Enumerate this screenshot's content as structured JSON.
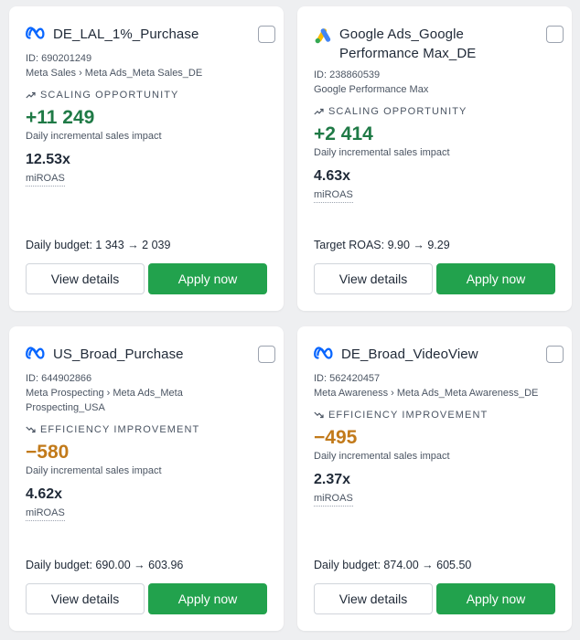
{
  "colors": {
    "positive": "#1f7a46",
    "negative": "#c27a1a",
    "apply_button": "#22a24d"
  },
  "cards": [
    {
      "platform_icon": "meta-logo",
      "title": "DE_LAL_1%_Purchase",
      "id_label": "ID: 690201249",
      "path": "Meta Sales › Meta Ads_Meta Sales_DE",
      "tag_icon": "trend-up-icon",
      "tag": "SCALING OPPORTUNITY",
      "impact": "+11 249",
      "impact_label": "Daily incremental sales impact",
      "metric": "12.53x",
      "metric_label": "miROAS",
      "budget": "Daily budget: 1 343 → 2 039",
      "view_label": "View details",
      "apply_label": "Apply now",
      "selected": false
    },
    {
      "platform_icon": "google-ads-logo",
      "title": "Google Ads_Google Performance Max_DE",
      "id_label": "ID: 238860539",
      "path": "Google Performance Max",
      "tag_icon": "trend-up-icon",
      "tag": "SCALING OPPORTUNITY",
      "impact": "+2 414",
      "impact_label": "Daily incremental sales impact",
      "metric": "4.63x",
      "metric_label": "miROAS",
      "budget": "Target ROAS: 9.90 → 9.29",
      "view_label": "View details",
      "apply_label": "Apply now",
      "selected": false
    },
    {
      "platform_icon": "meta-logo",
      "title": "US_Broad_Purchase",
      "id_label": "ID: 644902866",
      "path": "Meta Prospecting › Meta Ads_Meta Prospecting_USA",
      "tag_icon": "trend-down-icon",
      "tag": "EFFICIENCY IMPROVEMENT",
      "impact": "−580",
      "impact_label": "Daily incremental sales impact",
      "metric": "4.62x",
      "metric_label": "miROAS",
      "budget": "Daily budget: 690.00 → 603.96",
      "view_label": "View details",
      "apply_label": "Apply now",
      "selected": false
    },
    {
      "platform_icon": "meta-logo",
      "title": "DE_Broad_VideoView",
      "id_label": "ID: 562420457",
      "path": "Meta Awareness › Meta Ads_Meta Awareness_DE",
      "tag_icon": "trend-down-icon",
      "tag": "EFFICIENCY IMPROVEMENT",
      "impact": "−495",
      "impact_label": "Daily incremental sales impact",
      "metric": "2.37x",
      "metric_label": "miROAS",
      "budget": "Daily budget: 874.00 → 605.50",
      "view_label": "View details",
      "apply_label": "Apply now",
      "selected": false
    }
  ]
}
